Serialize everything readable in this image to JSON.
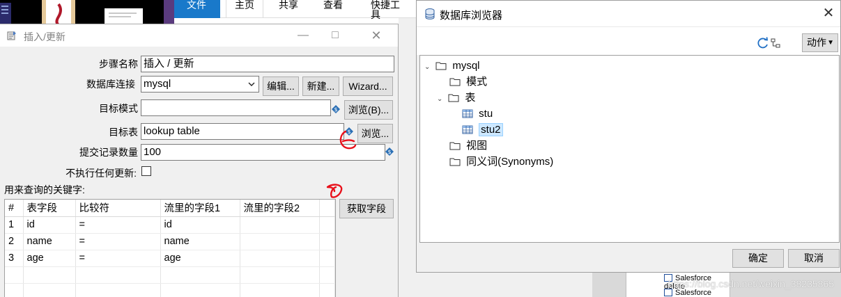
{
  "background": {
    "ribbon_tabs": [
      "文件",
      "主页",
      "共享",
      "查看",
      "快捷工具"
    ],
    "plugin_items": [
      "Salesforce delete",
      "Salesforce insert"
    ],
    "watermark": "https://blog.csdn.net/weixin_38235865"
  },
  "insert_update_dialog": {
    "title": "插入/更新",
    "labels": {
      "step_name": "步骤名称",
      "connection": "数据库连接",
      "target_schema": "目标模式",
      "target_table": "目标表",
      "commit_size": "提交记录数量",
      "no_update": "不执行任何更新:",
      "lookup_keys": "用来查询的关键字:"
    },
    "values": {
      "step_name": "插入 / 更新",
      "connection": "mysql",
      "target_schema": "",
      "target_table": "lookup table",
      "commit_size": "100",
      "no_update_checked": false
    },
    "buttons": {
      "edit": "编辑...",
      "new": "新建...",
      "wizard": "Wizard...",
      "browse_schema": "浏览(B)...",
      "browse_table": "浏览...",
      "get_fields": "获取字段"
    },
    "keys_table": {
      "columns": [
        "#",
        "表字段",
        "比较符",
        "流里的字段1",
        "流里的字段2"
      ],
      "rows": [
        [
          "1",
          "id",
          "=",
          "id",
          ""
        ],
        [
          "2",
          "name",
          "=",
          "name",
          ""
        ],
        [
          "3",
          "age",
          "=",
          "age",
          ""
        ]
      ]
    }
  },
  "db_browser": {
    "title": "数据库浏览器",
    "action_button": "动作",
    "tree": {
      "root": "mysql",
      "schemas": "模式",
      "tables": "表",
      "table_items": [
        "stu",
        "stu2"
      ],
      "selected": "stu2",
      "views": "视图",
      "synonyms": "同义词(Synonyms)"
    },
    "ok": "确定",
    "cancel": "取消"
  },
  "colors": {
    "accent_blue": "#1979ca",
    "selection": "#cde8ff",
    "annotation_red": "#e8101a"
  }
}
